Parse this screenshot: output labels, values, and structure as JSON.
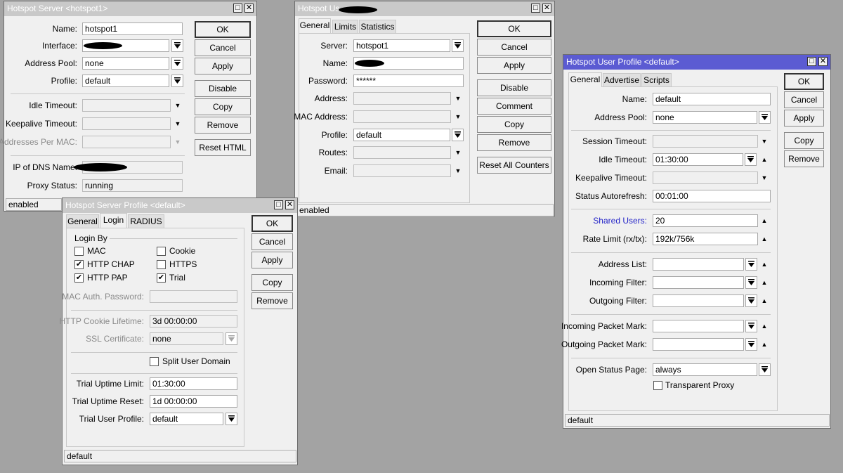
{
  "server": {
    "title": "Hotspot Server <hotspot1>",
    "fields": {
      "name": {
        "label": "Name:",
        "value": "hotspot1"
      },
      "interface": {
        "label": "Interface:"
      },
      "address_pool": {
        "label": "Address Pool:",
        "value": "none"
      },
      "profile": {
        "label": "Profile:",
        "value": "default"
      },
      "idle_timeout": {
        "label": "Idle Timeout:"
      },
      "keepalive_timeout": {
        "label": "Keepalive Timeout:"
      },
      "addresses_per_mac": {
        "label": "Addresses Per MAC:"
      },
      "ip_of_dns_name": {
        "label": "IP of DNS Name:"
      },
      "proxy_status": {
        "label": "Proxy Status:",
        "value": "running"
      }
    },
    "buttons": [
      "OK",
      "Cancel",
      "Apply",
      "Disable",
      "Copy",
      "Remove",
      "Reset HTML"
    ],
    "status": "enabled"
  },
  "user": {
    "title": "Hotspot Us",
    "tabs": [
      "General",
      "Limits",
      "Statistics"
    ],
    "fields": {
      "server": {
        "label": "Server:",
        "value": "hotspot1"
      },
      "name": {
        "label": "Name:"
      },
      "password": {
        "label": "Password:",
        "value": "******"
      },
      "address": {
        "label": "Address:"
      },
      "mac_address": {
        "label": "MAC Address:"
      },
      "profile": {
        "label": "Profile:",
        "value": "default"
      },
      "routes": {
        "label": "Routes:"
      },
      "email": {
        "label": "Email:"
      }
    },
    "buttons": [
      "OK",
      "Cancel",
      "Apply",
      "Disable",
      "Comment",
      "Copy",
      "Remove",
      "Reset All Counters"
    ],
    "status": "enabled"
  },
  "server_profile": {
    "title": "Hotspot Server Profile <default>",
    "tabs": [
      "General",
      "Login",
      "RADIUS"
    ],
    "login_by": {
      "label": "Login By",
      "options": [
        {
          "label": "MAC",
          "checked": false
        },
        {
          "label": "HTTP CHAP",
          "checked": true
        },
        {
          "label": "HTTP PAP",
          "checked": true
        },
        {
          "label": "Cookie",
          "checked": false
        },
        {
          "label": "HTTPS",
          "checked": false
        },
        {
          "label": "Trial",
          "checked": true
        }
      ]
    },
    "fields": {
      "mac_auth_password": {
        "label": "MAC Auth. Password:"
      },
      "http_cookie_lifetime": {
        "label": "HTTP Cookie Lifetime:",
        "value": "3d 00:00:00"
      },
      "ssl_certificate": {
        "label": "SSL Certificate:",
        "value": "none"
      },
      "split_user_domain": {
        "label": "Split User Domain",
        "checked": false
      },
      "trial_uptime_limit": {
        "label": "Trial Uptime Limit:",
        "value": "01:30:00"
      },
      "trial_uptime_reset": {
        "label": "Trial Uptime Reset:",
        "value": "1d 00:00:00"
      },
      "trial_user_profile": {
        "label": "Trial User Profile:",
        "value": "default"
      }
    },
    "buttons": [
      "OK",
      "Cancel",
      "Apply",
      "Copy",
      "Remove"
    ],
    "status": "default"
  },
  "user_profile": {
    "title": "Hotspot User Profile <default>",
    "tabs": [
      "General",
      "Advertise",
      "Scripts"
    ],
    "fields": {
      "name": {
        "label": "Name:",
        "value": "default"
      },
      "address_pool": {
        "label": "Address Pool:",
        "value": "none"
      },
      "session_timeout": {
        "label": "Session Timeout:"
      },
      "idle_timeout": {
        "label": "Idle Timeout:",
        "value": "01:30:00"
      },
      "keepalive_timeout": {
        "label": "Keepalive Timeout:"
      },
      "status_autorefresh": {
        "label": "Status Autorefresh:",
        "value": "00:01:00"
      },
      "shared_users": {
        "label": "Shared Users:",
        "value": "20"
      },
      "rate_limit": {
        "label": "Rate Limit (rx/tx):",
        "value": "192k/756k"
      },
      "address_list": {
        "label": "Address List:"
      },
      "incoming_filter": {
        "label": "Incoming Filter:"
      },
      "outgoing_filter": {
        "label": "Outgoing Filter:"
      },
      "incoming_packet_mark": {
        "label": "Incoming Packet Mark:"
      },
      "outgoing_packet_mark": {
        "label": "Outgoing Packet Mark:"
      },
      "open_status_page": {
        "label": "Open Status Page:",
        "value": "always"
      },
      "transparent_proxy": {
        "label": "Transparent Proxy",
        "checked": false
      }
    },
    "buttons": [
      "OK",
      "Cancel",
      "Apply",
      "Copy",
      "Remove"
    ],
    "status": "default"
  },
  "colors": {
    "desktop": "#a3a3a3",
    "active_title": "#5b5bd2",
    "inactive_title": "#c9c9c9",
    "shared_users_label": "#2424c8"
  }
}
